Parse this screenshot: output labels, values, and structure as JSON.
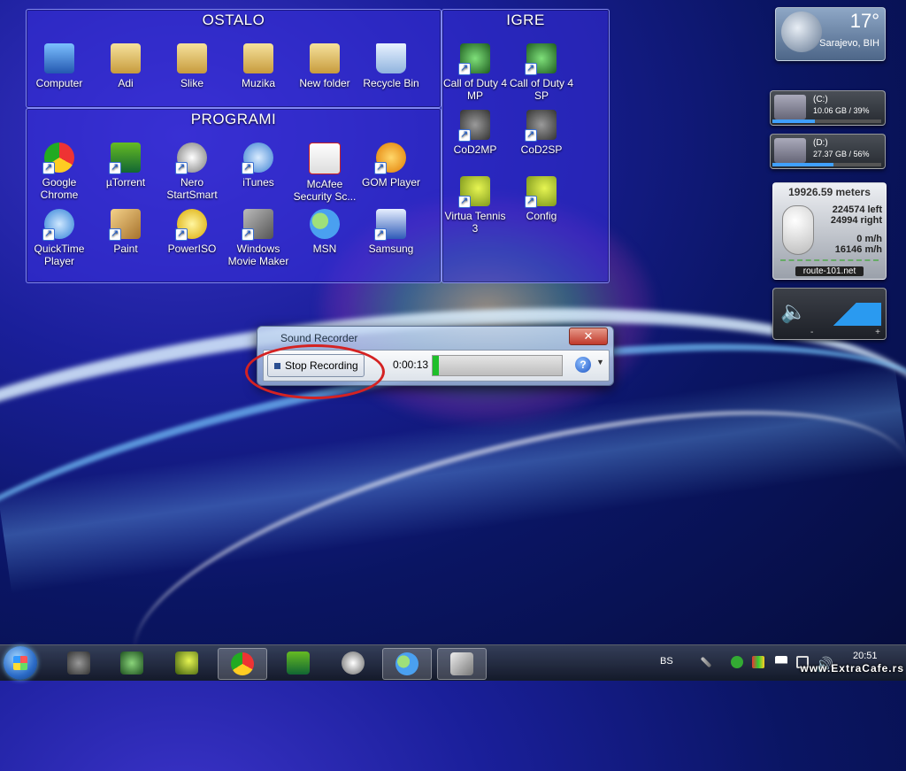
{
  "fences": {
    "ostalo": {
      "title": "OSTALO",
      "items": [
        "Computer",
        "Adi",
        "Slike",
        "Muzika",
        "New folder",
        "Recycle Bin"
      ]
    },
    "igre": {
      "title": "IGRE",
      "items": [
        "Call of Duty 4 MP",
        "Call of Duty 4 SP",
        "CoD2MP",
        "CoD2SP",
        "Virtua Tennis 3",
        "Config"
      ]
    },
    "programi": {
      "title": "PROGRAMI",
      "items": [
        "Google Chrome",
        "µTorrent",
        "Nero StartSmart",
        "iTunes",
        "McAfee Security Sc...",
        "GOM Player",
        "QuickTime Player",
        "Paint",
        "PowerISO",
        "Windows Movie Maker",
        "MSN",
        "Samsung"
      ]
    }
  },
  "weather": {
    "temp": "17°",
    "city": "Sarajevo, BIH"
  },
  "drives": [
    {
      "name": "(C:)",
      "info": "10.06 GB / 39%",
      "percent": 39
    },
    {
      "name": "(D:)",
      "info": "27.37 GB / 56%",
      "percent": 56
    }
  ],
  "mouse_gadget": {
    "distance": "19926.59 meters",
    "left": "224574 left",
    "right": "24994 right",
    "speed1": "0 m/h",
    "speed2": "16146 m/h",
    "site": "route-101.net"
  },
  "volume": {
    "minus": "-",
    "plus": "+"
  },
  "recorder": {
    "title": "Sound Recorder",
    "close": "✕",
    "stop_label": "Stop Recording",
    "time": "0:00:13",
    "level": 0.05,
    "help": "?",
    "dropdown": "▼"
  },
  "taskbar": {
    "lang": "BS",
    "time": "20:51",
    "apps": [
      "call-of-duty",
      "cod-soldier",
      "virtua-tennis",
      "google-chrome",
      "utorrent",
      "nero",
      "msn",
      "sound-recorder"
    ]
  },
  "watermark": "www.ExtraCafe.rs"
}
